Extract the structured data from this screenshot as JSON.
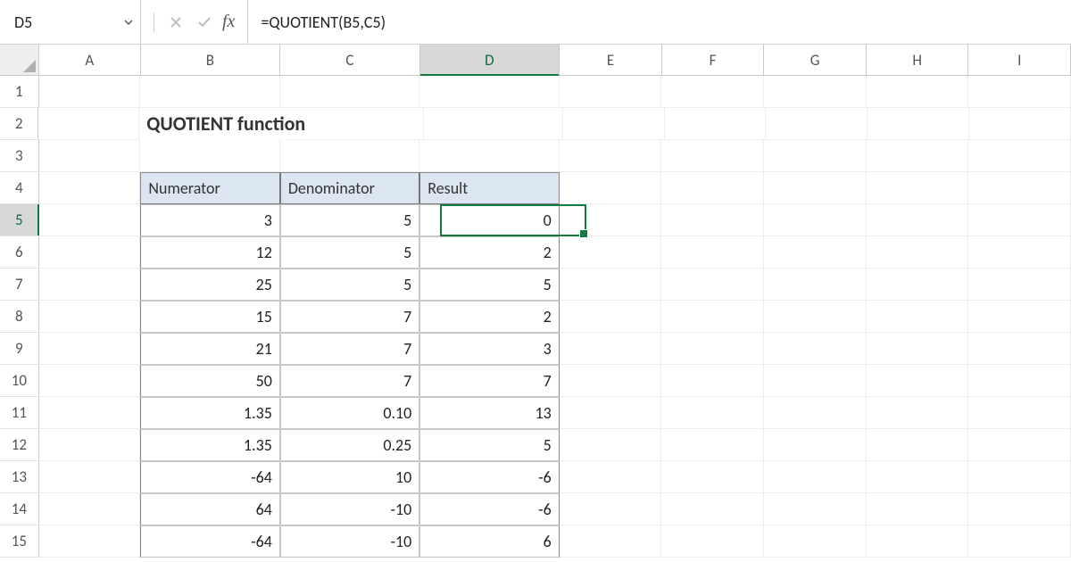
{
  "formula_bar": {
    "name_box": "D5",
    "fx_label": "fx",
    "formula": "=QUOTIENT(B5,C5)"
  },
  "columns": [
    "A",
    "B",
    "C",
    "D",
    "E",
    "F",
    "G",
    "H",
    "I"
  ],
  "active_column": "D",
  "active_row": 5,
  "row_labels": [
    "1",
    "2",
    "3",
    "4",
    "5",
    "6",
    "7",
    "8",
    "9",
    "10",
    "11",
    "12",
    "13",
    "14",
    "15"
  ],
  "title": "QUOTIENT function",
  "headers": {
    "b": "Numerator",
    "c": "Denominator",
    "d": "Result"
  },
  "data_rows": [
    {
      "b": "3",
      "c": "5",
      "d": "0"
    },
    {
      "b": "12",
      "c": "5",
      "d": "2"
    },
    {
      "b": "25",
      "c": "5",
      "d": "5"
    },
    {
      "b": "15",
      "c": "7",
      "d": "2"
    },
    {
      "b": "21",
      "c": "7",
      "d": "3"
    },
    {
      "b": "50",
      "c": "7",
      "d": "7"
    },
    {
      "b": "1.35",
      "c": "0.10",
      "d": "13"
    },
    {
      "b": "1.35",
      "c": "0.25",
      "d": "5"
    },
    {
      "b": "-64",
      "c": "10",
      "d": "-6"
    },
    {
      "b": "64",
      "c": "-10",
      "d": "-6"
    },
    {
      "b": "-64",
      "c": "-10",
      "d": "6"
    }
  ]
}
